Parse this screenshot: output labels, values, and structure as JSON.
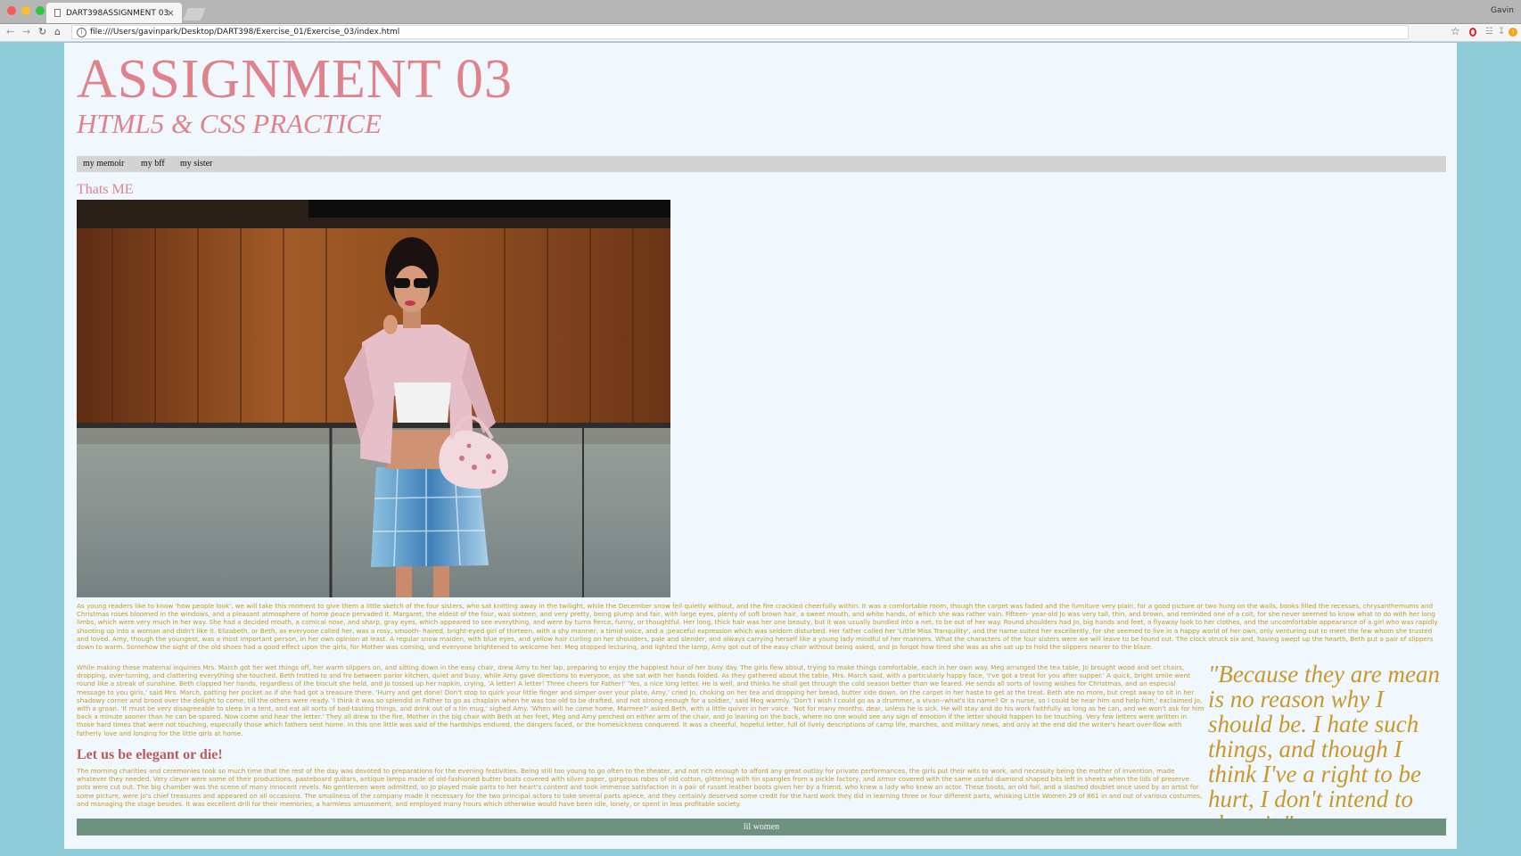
{
  "browser": {
    "tab_title": "DART398ASSIGNMENT 03",
    "tab_close": "×",
    "user_name": "Gavin",
    "url": "file:///Users/gavinpark/Desktop/DART398/Exercise_01/Exercise_03/index.html",
    "icons": [
      "back-icon",
      "forward-icon",
      "reload-icon",
      "home-icon",
      "info-icon",
      "star-icon",
      "opera-icon",
      "extension-icon"
    ]
  },
  "header": {
    "title": "ASSIGNMENT 03",
    "subtitle": "HTML5 & CSS PRACTICE"
  },
  "nav": {
    "items": [
      "my memoir",
      "my bff",
      "my sister"
    ]
  },
  "section1": {
    "heading": "Thats ME",
    "paragraph": "As young readers like to know 'how people look', we will take this moment to give them a little sketch of the four sisters, who sat knitting away in the twilight, while the December snow fell quietly without, and the fire crackled cheerfully within. It was a comfortable room, though the carpet was faded and the furniture very plain, for a good picture or two hung on the walls, books filled the recesses, chrysanthemums and Christmas roses bloomed in the windows, and a pleasant atmosphere of home peace pervaded it. Margaret, the eldest of the four, was sixteen, and very pretty, being plump and fair, with large eyes, plenty of soft brown hair, a sweet mouth, and white hands, of which she was rather vain. Fifteen- year-old Jo was very tall, thin, and brown, and reminded one of a colt, for she never seemed to know what to do with her long limbs, which were very much in her way. She had a decided mouth, a comical nose, and sharp, gray eyes, which appeared to see everything, and were by turns fierce, funny, or thoughtful. Her long, thick hair was her one beauty, but it was usually bundled into a net, to be out of her way. Round shoulders had Jo, big hands and feet, a flyaway look to her clothes, and the uncomfortable appearance of a girl who was rapidly shooting up into a woman and didn't like it. Elizabeth, or Beth, as everyone called her, was a rosy, smooth- haired, bright-eyed girl of thirteen, with a shy manner, a timid voice, and a ;peaceful expression which was seldom disturbed. Her father called her 'Little Miss Tranquility', and the name suited her excellently, for she seemed to live in a happy world of her own, only venturing out to meet the few whom she trusted and loved. Amy, though the youngest, was a most important person, in her own opinion at least. A regular snow maiden, with blue eyes, and yellow hair curling on her shoulders, pale and slender, and always carrying herself like a young lady mindful of her manners. What the characters of the four sisters were we will leave to be found out. The clock struck six and, having swept up the hearth, Beth put a pair of slippers down to warm. Somehow the sight of the old shoes had a good effect upon the girls, for Mother was coming, and everyone brightened to welcome her. Meg stopped lecturing, and lighted the lamp, Amy got out of the easy chair without being asked, and Jo forgot how tired she was as she sat up to hold the slippers nearer to the blaze."
  },
  "section2": {
    "paragraph": "While making these maternal inquiries Mrs. March got her wet things off, her warm slippers on, and sitting down in the easy chair, drew Amy to her lap, preparing to enjoy the happiest hour of her busy day. The girls flew about, trying to make things comfortable, each in her own way. Meg arranged the tea table, Jo brought wood and set chairs, dropping, over-turning, and clattering everything she touched. Beth trotted to and fro between parlor kitchen, quiet and busy, while Amy gave directions to everyone, as she sat with her hands folded. As they gathered about the table, Mrs. March said, with a particularly happy face, 'I've got a treat for you after supper.' A quick, bright smile went round like a streak of sunshine. Beth clapped her hands, regardless of the biscuit she held, and Jo tossed up her napkin, crying, 'A letter! A letter! Three cheers for Father!' 'Yes, a nice long letter. He is well, and thinks he shall get through the cold season better than we feared. He sends all sorts of loving wishes for Christmas, and an especial message to you girls,' said Mrs. March, patting her pocket as if she had got a treasure there. 'Hurry and get done! Don't stop to quirk your little finger and simper over your plate, Amy,' cried Jo, choking on her tea and dropping her bread, butter side down, on the carpet in her haste to get at the treat. Beth ate no more, but crept away to sit in her shadowy corner and brood over the delight to come, till the others were ready. 'I think it was so splendid in Father to go as chaplain when he was too old to be drafted, and not strong enough for a soldier,' said Meg warmly. 'Don't I wish I could go as a drummer, a vivan--what's its name? Or a nurse, so I could be near him and help him,' exclaimed Jo, with a groan. 'It must be very disagreeable to sleep in a tent, and eat all sorts of bad-tasting things, and drink out of a tin mug,' sighed Amy. 'When will he come home, Marmee?' asked Beth, with a little quiver in her voice. 'Not for many months, dear, unless he is sick. He will stay and do his work faithfully as long as he can, and we won't ask for him back a minute sooner than he can be spared. Now come and hear the letter.' They all drew to the fire, Mother in the big chair with Beth at her feet, Meg and Amy perched on either arm of the chair, and Jo leaning on the back, where no one would see any sign of emotion if the letter should happen to be touching. Very few letters were written in those hard times that were not touching, especially those which fathers sent home. In this one little was said of the hardships endured, the dangers faced, or the homesickness conquered. It was a cheerful, hopeful letter, full of lively descriptions of camp life, marches, and military news, and only at the end did the writer's heart over-flow with fatherly love and longing for the little girls at home.",
    "quote": "\"Because they are mean is no reason why I should be. I hate such things, and though I think I've a right to be hurt, I don't intend to show it.\""
  },
  "section3": {
    "heading": "Let us be elegant or die!",
    "paragraph": "The morning charities and ceremonies took so much time that the rest of the day was devoted to preparations for the evening festivities. Being still too young to go often to the theater, and not rich enough to afford any great outlay for private performances, the girls put their wits to work, and necessity being the mother of invention, made whatever they needed. Very clever were some of their productions, pasteboard guitars, antique lamps made of old-fashioned butter boats covered with silver paper, gorgeous robes of old cotton, glittering with tin spangles from a pickle factory, and armor covered with the same useful diamond shaped bits left in sheets when the lids of preserve pots were cut out. The big chamber was the scene of many innocent revels. No gentlemen were admitted, so Jo played male parts to her heart's content and took immense satisfaction in a pair of russet leather boots given her by a friend, who knew a lady who knew an actor. These boots, an old foil, and a slashed doublet once used by an artist for some picture, were Jo's chief treasures and appeared on all occasions. The smallness of the company made it necessary for the two principal actors to take several parts apiece, and they certainly deserved some credit for the hard work they did in learning three or four different parts, whisking Little Women 29 of 861 in and out of various costumes, and managing the stage besides. It was excellent drill for their memories, a harmless amusement, and employed many hours which otherwise would have been idle, lonely, or spent in less profitable society."
  },
  "footer": {
    "text": "lil women"
  },
  "colors": {
    "page_background": "#8ecbd9",
    "content_background": "#f0f8fd",
    "heading_pink": "#e0828b",
    "heading_red": "#bb5a5a",
    "text_gold": "#c39a23",
    "nav_gray": "#d3d3d3",
    "footer_green": "#6f9280"
  }
}
